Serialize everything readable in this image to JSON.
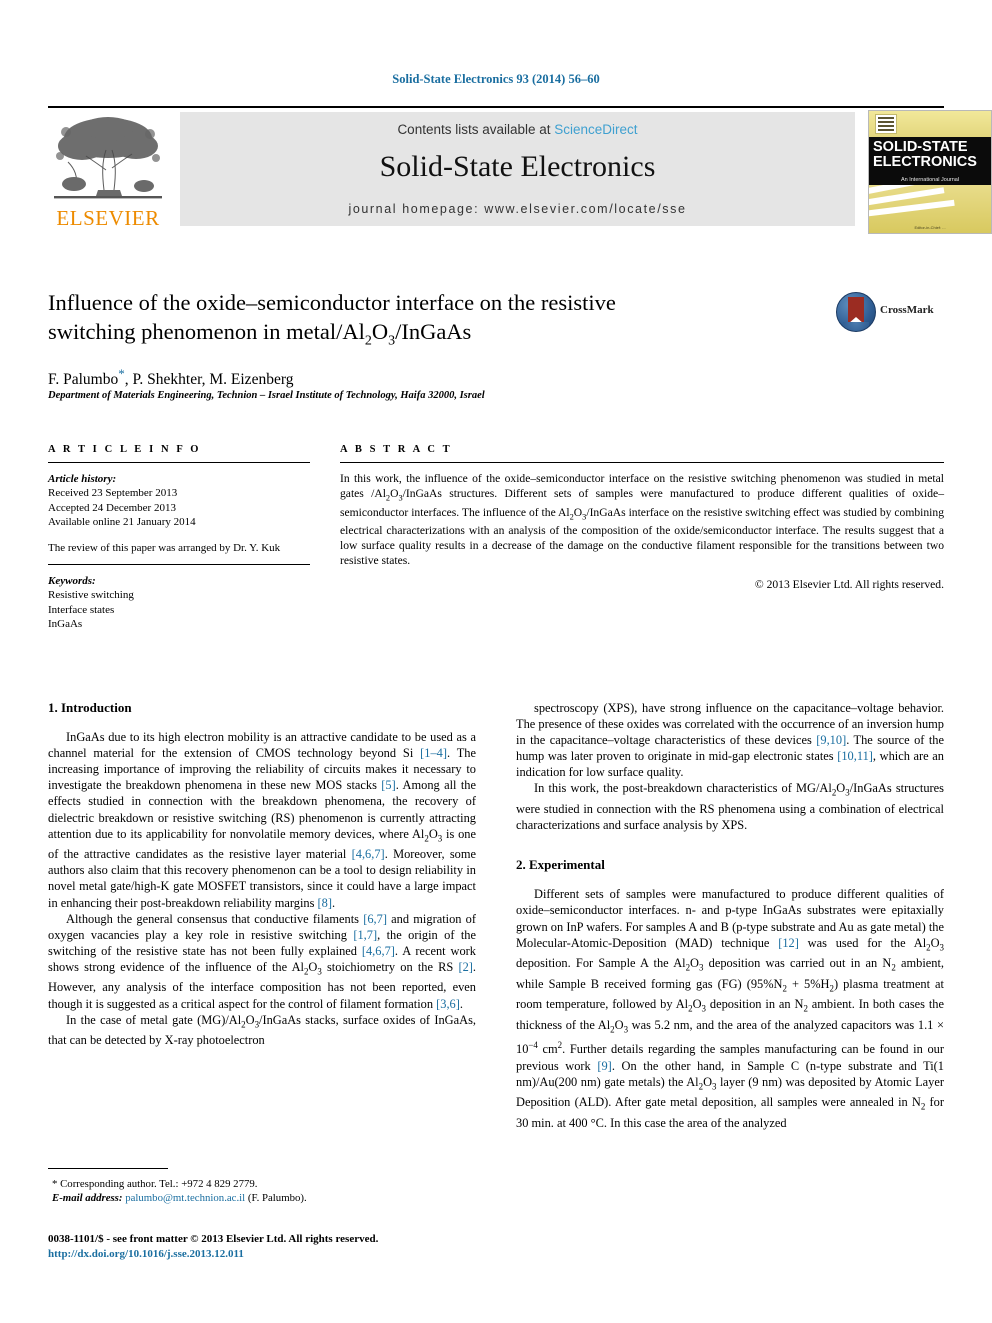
{
  "runninghead": "Solid-State Electronics 93 (2014) 56–60",
  "masthead": {
    "contents_prefix": "Contents lists available at ",
    "sciencedirect": "ScienceDirect",
    "journal_title": "Solid-State Electronics",
    "homepage": "journal homepage: www.elsevier.com/locate/sse",
    "publisher_wordmark": "ELSEVIER",
    "publisher_color": "#ED8B00",
    "link_color": "#3fa0d0",
    "banner_bg": "#e5e5e5",
    "cover": {
      "line1": "SOLID-STATE",
      "line2": "ELECTRONICS",
      "subtitle": "An International Journal",
      "credit": "Editor-in-Chief: ...",
      "band_color": "#0b0b0b",
      "paper_color": "#d9cf7a"
    }
  },
  "article": {
    "title_part1": "Influence of the oxide–semiconductor interface on the resistive",
    "title_part2_a": "switching phenomenon in metal/Al",
    "title_sub1": "2",
    "title_part2_b": "O",
    "title_sub2": "3",
    "title_part2_c": "/InGaAs",
    "authors": "F. Palumbo",
    "authors_rest": ", P. Shekhter, M. Eizenberg",
    "star": "*",
    "affiliation": "Department of Materials Engineering, Technion – Israel Institute of Technology, Haifa 32000, Israel",
    "crossmark_label": "CrossMark"
  },
  "info": {
    "heading": "A R T I C L E   I N F O",
    "history_label": "Article history:",
    "received": "Received 23 September 2013",
    "accepted": "Accepted 24 December 2013",
    "available": "Available online 21 January 2014",
    "editor_note": "The review of this paper was arranged by Dr. Y. Kuk",
    "keywords_label": "Keywords:",
    "keywords": [
      "Resistive switching",
      "Interface states",
      "InGaAs"
    ]
  },
  "abstract": {
    "heading": "A B S T R A C T",
    "body": "In this work, the influence of the oxide–semiconductor interface on the resistive switching phenomenon was studied in metal gates /Al2O3/InGaAs structures. Different sets of samples were manufactured to produce different qualities of oxide–semiconductor interfaces. The influence of the Al2O3/InGaAs interface on the resistive switching effect was studied by combining electrical characterizations with an analysis of the composition of the oxide/semiconductor interface. The results suggest that a low surface quality results in a decrease of the damage on the conductive filament responsible for the transitions between two resistive states.",
    "copyright": "© 2013 Elsevier Ltd. All rights reserved."
  },
  "body": {
    "section1_heading": "1. Introduction",
    "section2_heading": "2. Experimental",
    "left_p1": "InGaAs due to its high electron mobility is an attractive candidate to be used as a channel material for the extension of CMOS technology beyond Si [1–4]. The increasing importance of improving the reliability of circuits makes it necessary to investigate the breakdown phenomena in these new MOS stacks [5]. Among all the effects studied in connection with the breakdown phenomena, the recovery of dielectric breakdown or resistive switching (RS) phenomenon is currently attracting attention due to its applicability for nonvolatile memory devices, where Al2O3 is one of the attractive candidates as the resistive layer material [4,6,7]. Moreover, some authors also claim that this recovery phenomenon can be a tool to design reliability in novel metal gate/high-K gate MOSFET transistors, since it could have a large impact in enhancing their post-breakdown reliability margins [8].",
    "left_p2": "Although the general consensus that conductive filaments [6,7] and migration of oxygen vacancies play a key role in resistive switching [1,7], the origin of the switching of the resistive state has not been fully explained [4,6,7]. A recent work shows strong evidence of the influence of the Al2O3 stoichiometry on the RS [2]. However, any analysis of the interface composition has not been reported, even though it is suggested as a critical aspect for the control of filament formation [3,6].",
    "left_p3": "In the case of metal gate (MG)/Al2O3/InGaAs stacks, surface oxides of InGaAs, that can be detected by X-ray photoelectron",
    "right_p1": "spectroscopy (XPS), have strong influence on the capacitance–voltage behavior. The presence of these oxides was correlated with the occurrence of an inversion hump in the capacitance–voltage characteristics of these devices [9,10]. The source of the hump was later proven to originate in mid-gap electronic states [10,11], which are an indication for low surface quality.",
    "right_p2": "In this work, the post-breakdown characteristics of MG/Al2O3/InGaAs structures were studied in connection with the RS phenomena using a combination of electrical characterizations and surface analysis by XPS.",
    "right_p3": "Different sets of samples were manufactured to produce different qualities of oxide–semiconductor interfaces. n- and p-type InGaAs substrates were epitaxially grown on InP wafers. For samples A and B (p-type substrate and Au as gate metal) the Molecular-Atomic-Deposition (MAD) technique [12] was used for the Al2O3 deposition. For Sample A the Al2O3 deposition was carried out in an N2 ambient, while Sample B received forming gas (FG) (95%N2 + 5%H2) plasma treatment at room temperature, followed by Al2O3 deposition in an N2 ambient. In both cases the thickness of the Al2O3 was 5.2 nm, and the area of the analyzed capacitors was 1.1 × 10−4 cm2. Further details regarding the samples manufacturing can be found in our previous work [9]. On the other hand, in Sample C (n-type substrate and Ti(1 nm)/Au(200 nm) gate metals) the Al2O3 layer (9 nm) was deposited by Atomic Layer Deposition (ALD). After gate metal deposition, all samples were annealed in N2 for 30 min. at 400 °C. In this case the area of the analyzed"
  },
  "footnote": {
    "corresponding": "* Corresponding author. Tel.: +972 4 829 2779.",
    "email_label": "E-mail address:",
    "email": "palumbo@mt.technion.ac.il",
    "email_suffix": " (F. Palumbo).",
    "imprint": "0038-1101/$ - see front matter © 2013 Elsevier Ltd. All rights reserved.",
    "doi": "http://dx.doi.org/10.1016/j.sse.2013.12.011"
  },
  "colors": {
    "link": "#1a6ea0",
    "reference": "#1a6ea0",
    "runninghead": "#1a6ea0"
  }
}
